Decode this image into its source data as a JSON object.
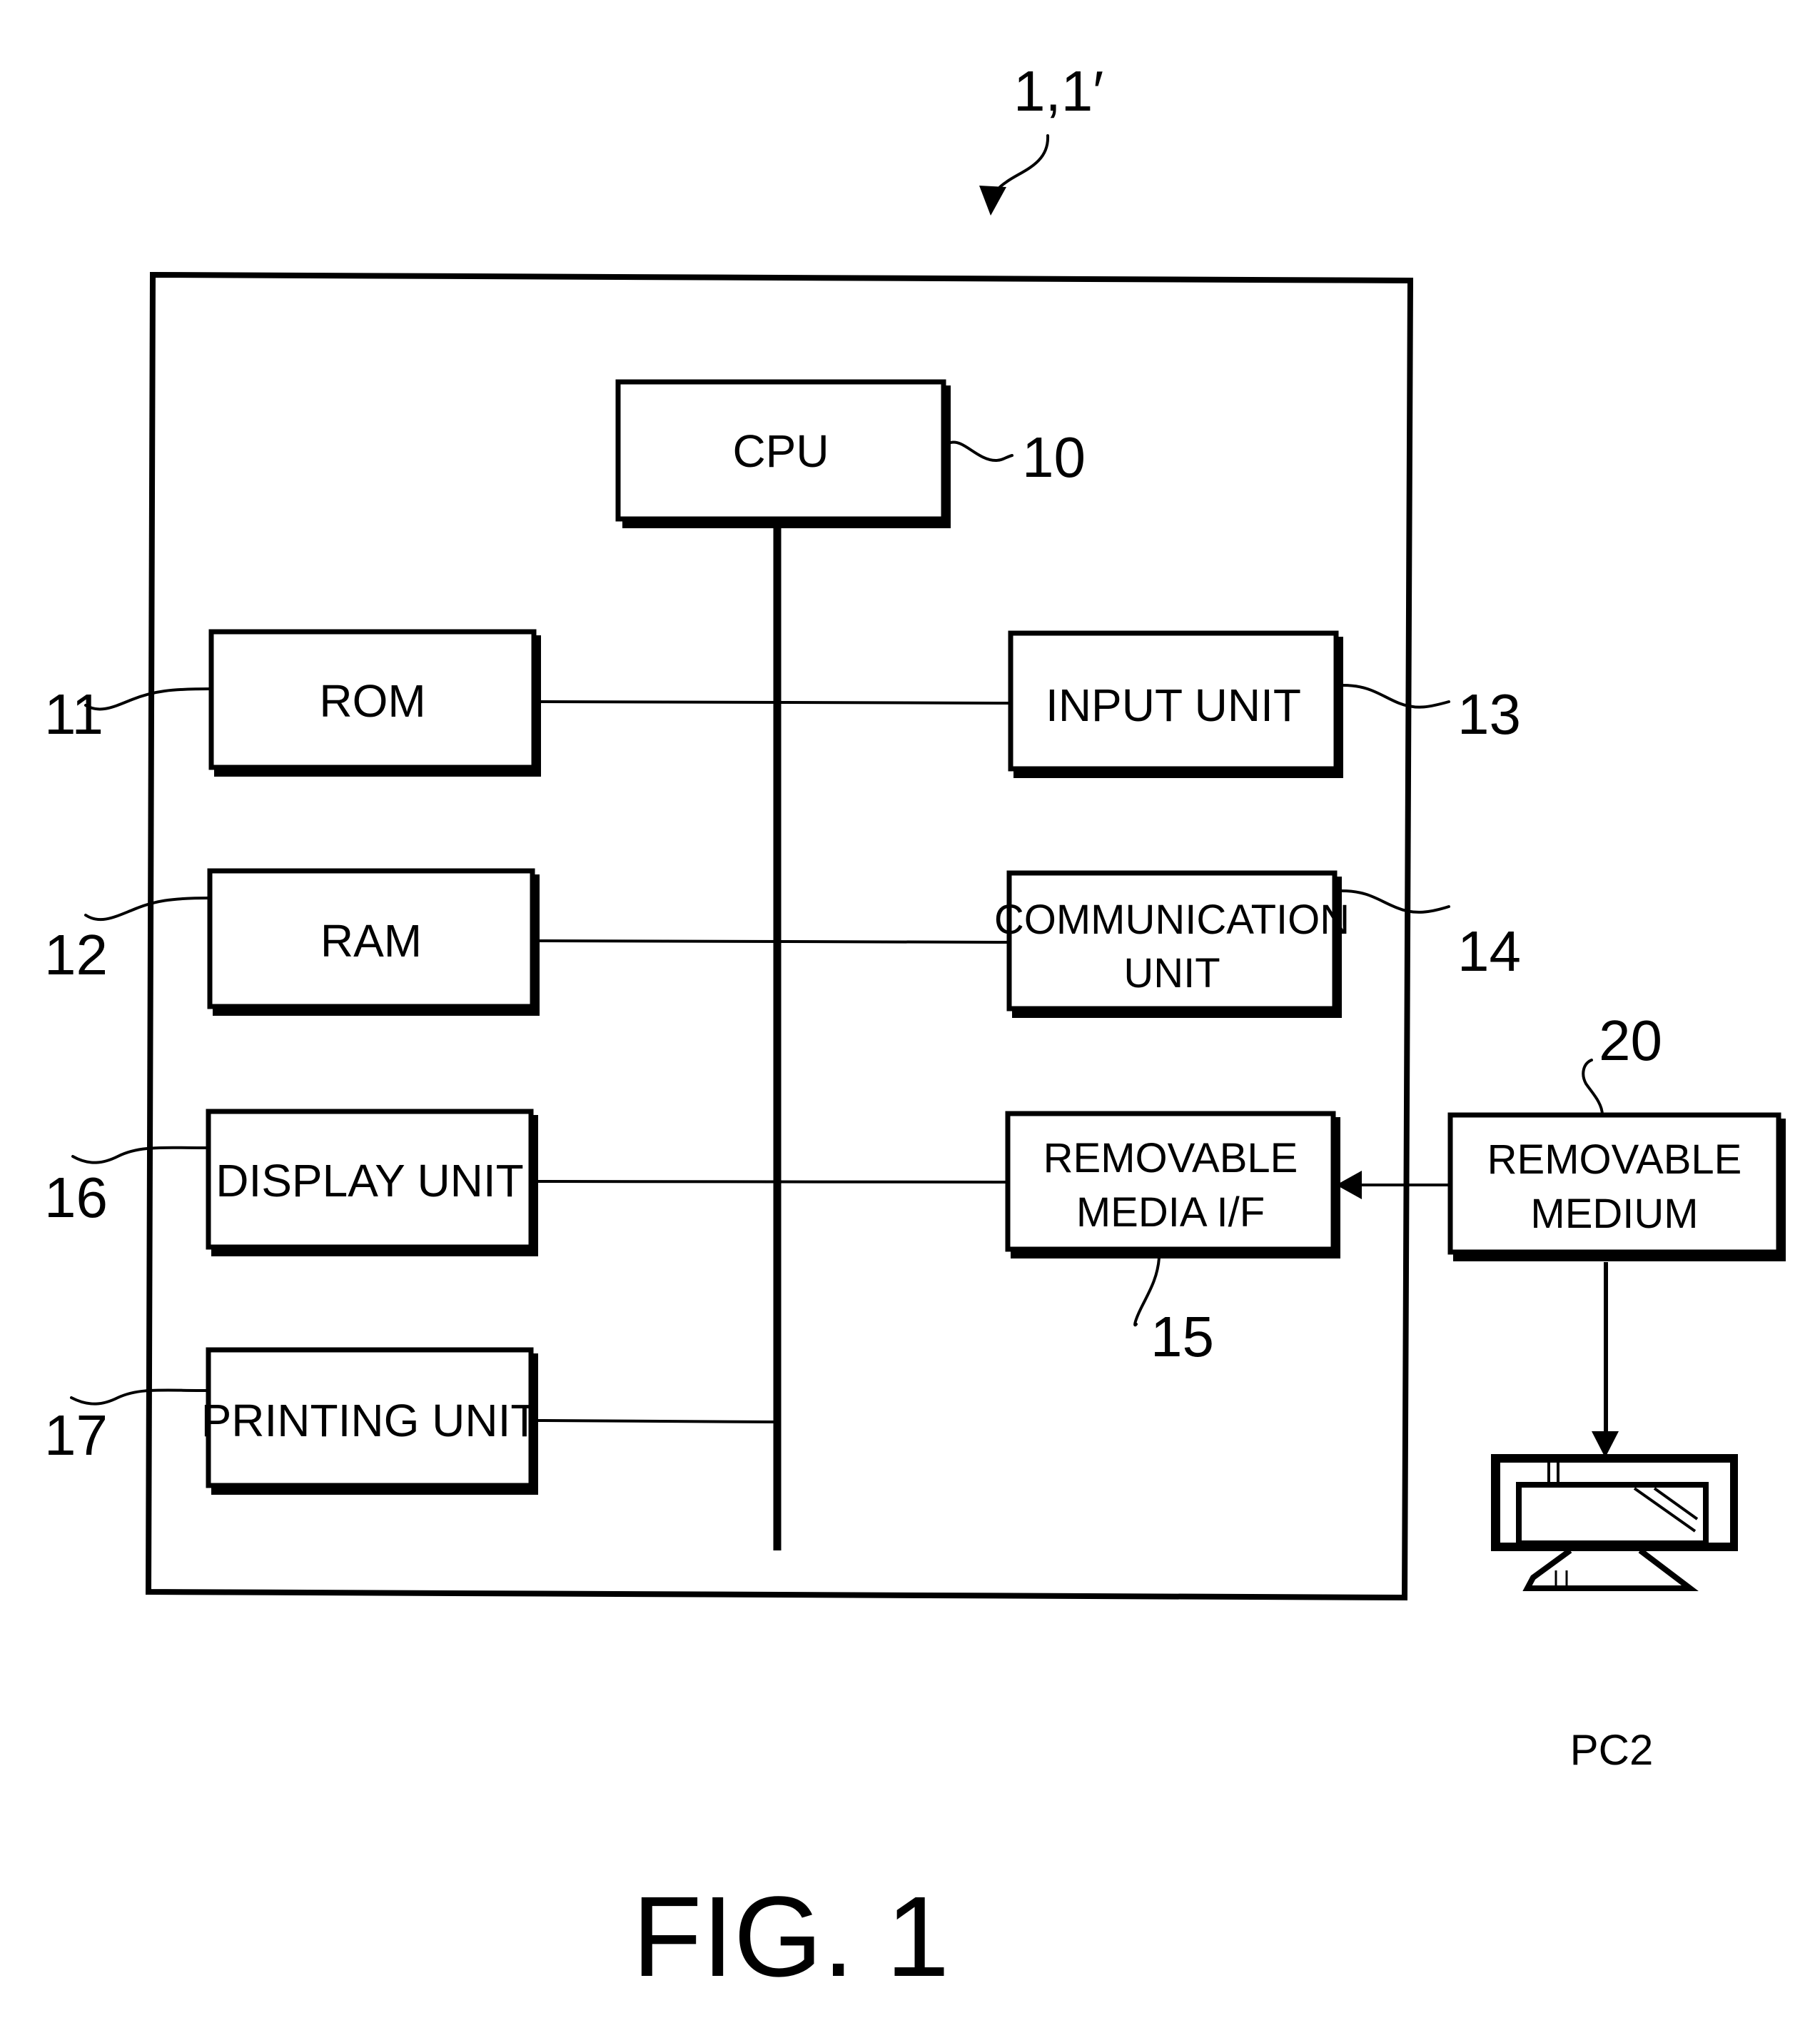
{
  "figure": {
    "caption": "FIG. 1",
    "device_reference": "1,1′"
  },
  "blocks": {
    "cpu": {
      "label_lines": [
        "CPU"
      ],
      "ref": "10"
    },
    "rom": {
      "label_lines": [
        "ROM"
      ],
      "ref": "11"
    },
    "ram": {
      "label_lines": [
        "RAM"
      ],
      "ref": "12"
    },
    "input_unit": {
      "label_lines": [
        "INPUT UNIT"
      ],
      "ref": "13"
    },
    "communication_unit": {
      "label_lines": [
        "COMMUNICATION",
        "UNIT"
      ],
      "ref": "14"
    },
    "removable_media_if": {
      "label_lines": [
        "REMOVABLE",
        "MEDIA I/F"
      ],
      "ref": "15"
    },
    "display_unit": {
      "label_lines": [
        "DISPLAY UNIT"
      ],
      "ref": "16"
    },
    "printing_unit": {
      "label_lines": [
        "PRINTING UNIT"
      ],
      "ref": "17"
    },
    "removable_medium": {
      "label_lines": [
        "REMOVABLE",
        "MEDIUM"
      ],
      "ref": "20"
    }
  },
  "external": {
    "pc": {
      "label": "PC2",
      "icon": "computer-monitor-icon"
    }
  }
}
